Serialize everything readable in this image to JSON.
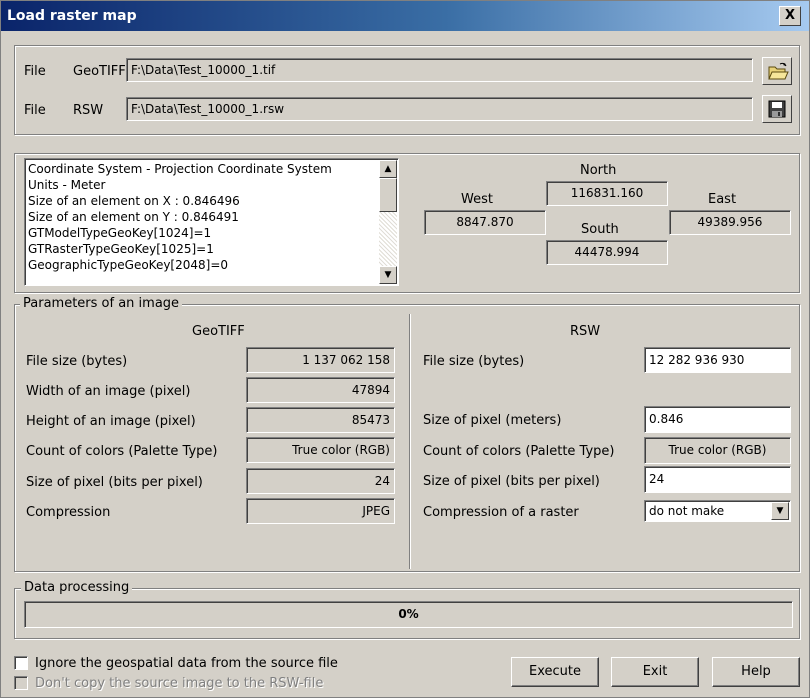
{
  "window": {
    "title": "Load raster map",
    "close_glyph": "X"
  },
  "files": {
    "geotiff": {
      "label1": "File",
      "label2": "GeoTIFF",
      "value": "F:\\Data\\Test_10000_1.tif",
      "button_icon": "open-folder-icon"
    },
    "rsw": {
      "label1": "File",
      "label2": "RSW",
      "value": "F:\\Data\\Test_10000_1.rsw",
      "button_icon": "save-disk-icon"
    }
  },
  "info_list": [
    "Coordinate System - Projection Coordinate System",
    "Units - Meter",
    "Size of an element on X : 0.846496",
    "Size of an element on Y : 0.846491",
    "GTModelTypeGeoKey[1024]=1",
    "GTRasterTypeGeoKey[1025]=1",
    "GeographicTypeGeoKey[2048]=0"
  ],
  "bounds": {
    "north_label": "North",
    "north": "116831.160",
    "west_label": "West",
    "west": "8847.870",
    "east_label": "East",
    "east": "49389.956",
    "south_label": "South",
    "south": "44478.994"
  },
  "params": {
    "title": "Parameters of an image",
    "geotiff": {
      "header": "GeoTIFF",
      "rows": [
        {
          "label": "File size (bytes)",
          "value": "1 137 062 158"
        },
        {
          "label": "Width of an image (pixel)",
          "value": "47894"
        },
        {
          "label": "Height of an image (pixel)",
          "value": "85473"
        },
        {
          "label": "Count of colors (Palette Type)",
          "value": "True color (RGB)"
        },
        {
          "label": "Size of pixel (bits per pixel)",
          "value": "24"
        },
        {
          "label": "Compression",
          "value": "JPEG"
        }
      ]
    },
    "rsw": {
      "header": "RSW",
      "file_size_label": "File size (bytes)",
      "file_size": "12 282 936 930",
      "pixel_size_label": "Size of pixel (meters)",
      "pixel_size": "0.846",
      "colors_label": "Count of colors (Palette Type)",
      "colors": "True color (RGB)",
      "bits_label": "Size of pixel (bits per pixel)",
      "bits": "24",
      "compression_label": "Compression of a raster",
      "compression": "do not make"
    }
  },
  "processing": {
    "title": "Data processing",
    "progress_text": "0%",
    "progress": 0
  },
  "options": {
    "ignore_geo": "Ignore the geospatial data from the source file",
    "dont_copy": "Don't copy the source image to the RSW-file"
  },
  "buttons": {
    "execute": "Execute",
    "exit": "Exit",
    "help": "Help"
  }
}
